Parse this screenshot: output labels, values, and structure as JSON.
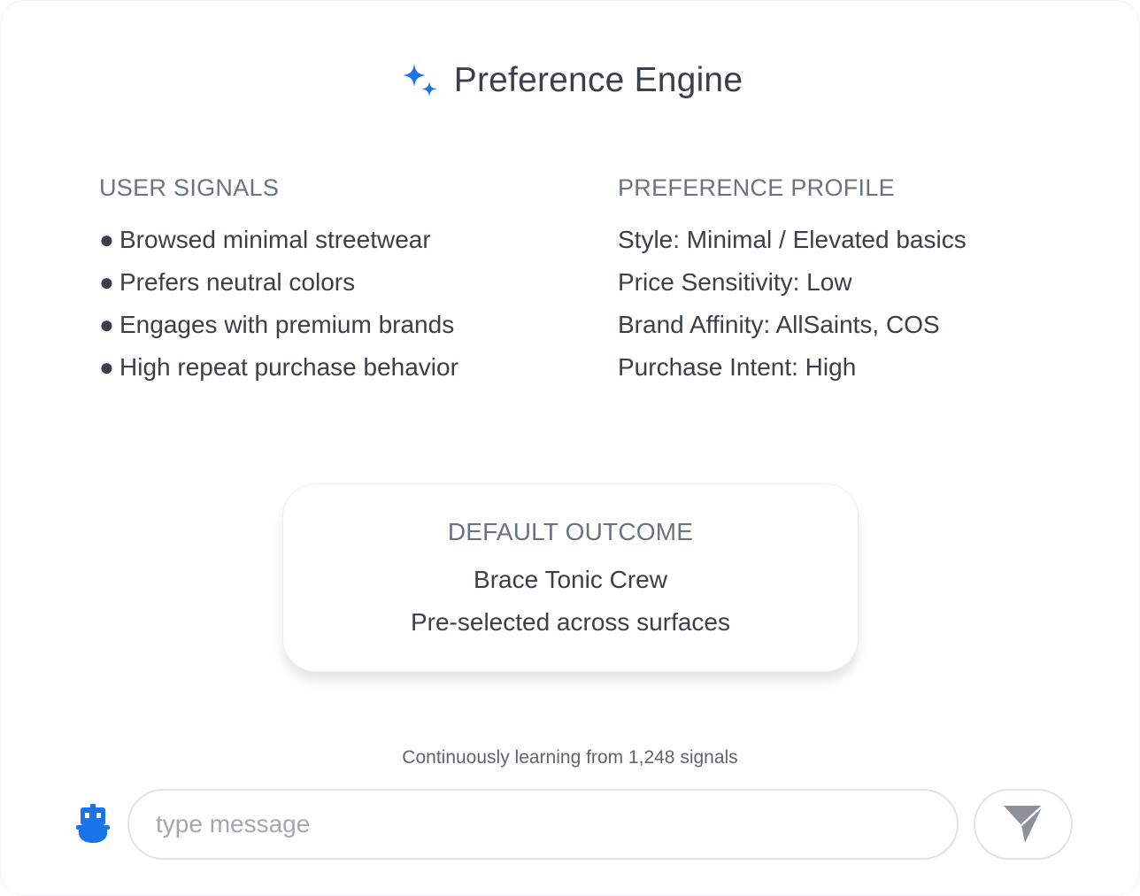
{
  "header": {
    "title": "Preference Engine",
    "icon": "sparkle-icon",
    "icon_color": "#1a73e8"
  },
  "user_signals": {
    "title": "USER SIGNALS",
    "bullet": "●",
    "items": [
      "Browsed minimal streetwear",
      "Prefers neutral colors",
      "Engages with premium brands",
      "High repeat purchase behavior"
    ]
  },
  "preference_profile": {
    "title": "PREFERENCE PROFILE",
    "items": [
      "Style: Minimal / Elevated basics",
      "Price Sensitivity: Low",
      "Brand Affinity: AllSaints, COS",
      "Purchase Intent: High"
    ]
  },
  "outcome": {
    "title": "DEFAULT OUTCOME",
    "product": "Brace Tonic Crew",
    "note": "Pre-selected across surfaces"
  },
  "status": {
    "text": "Continuously learning from 1,248 signals"
  },
  "composer": {
    "placeholder": "type message",
    "value": "",
    "bot_icon": "robot-icon",
    "send_icon": "send-icon",
    "accent": "#1a73e8"
  }
}
